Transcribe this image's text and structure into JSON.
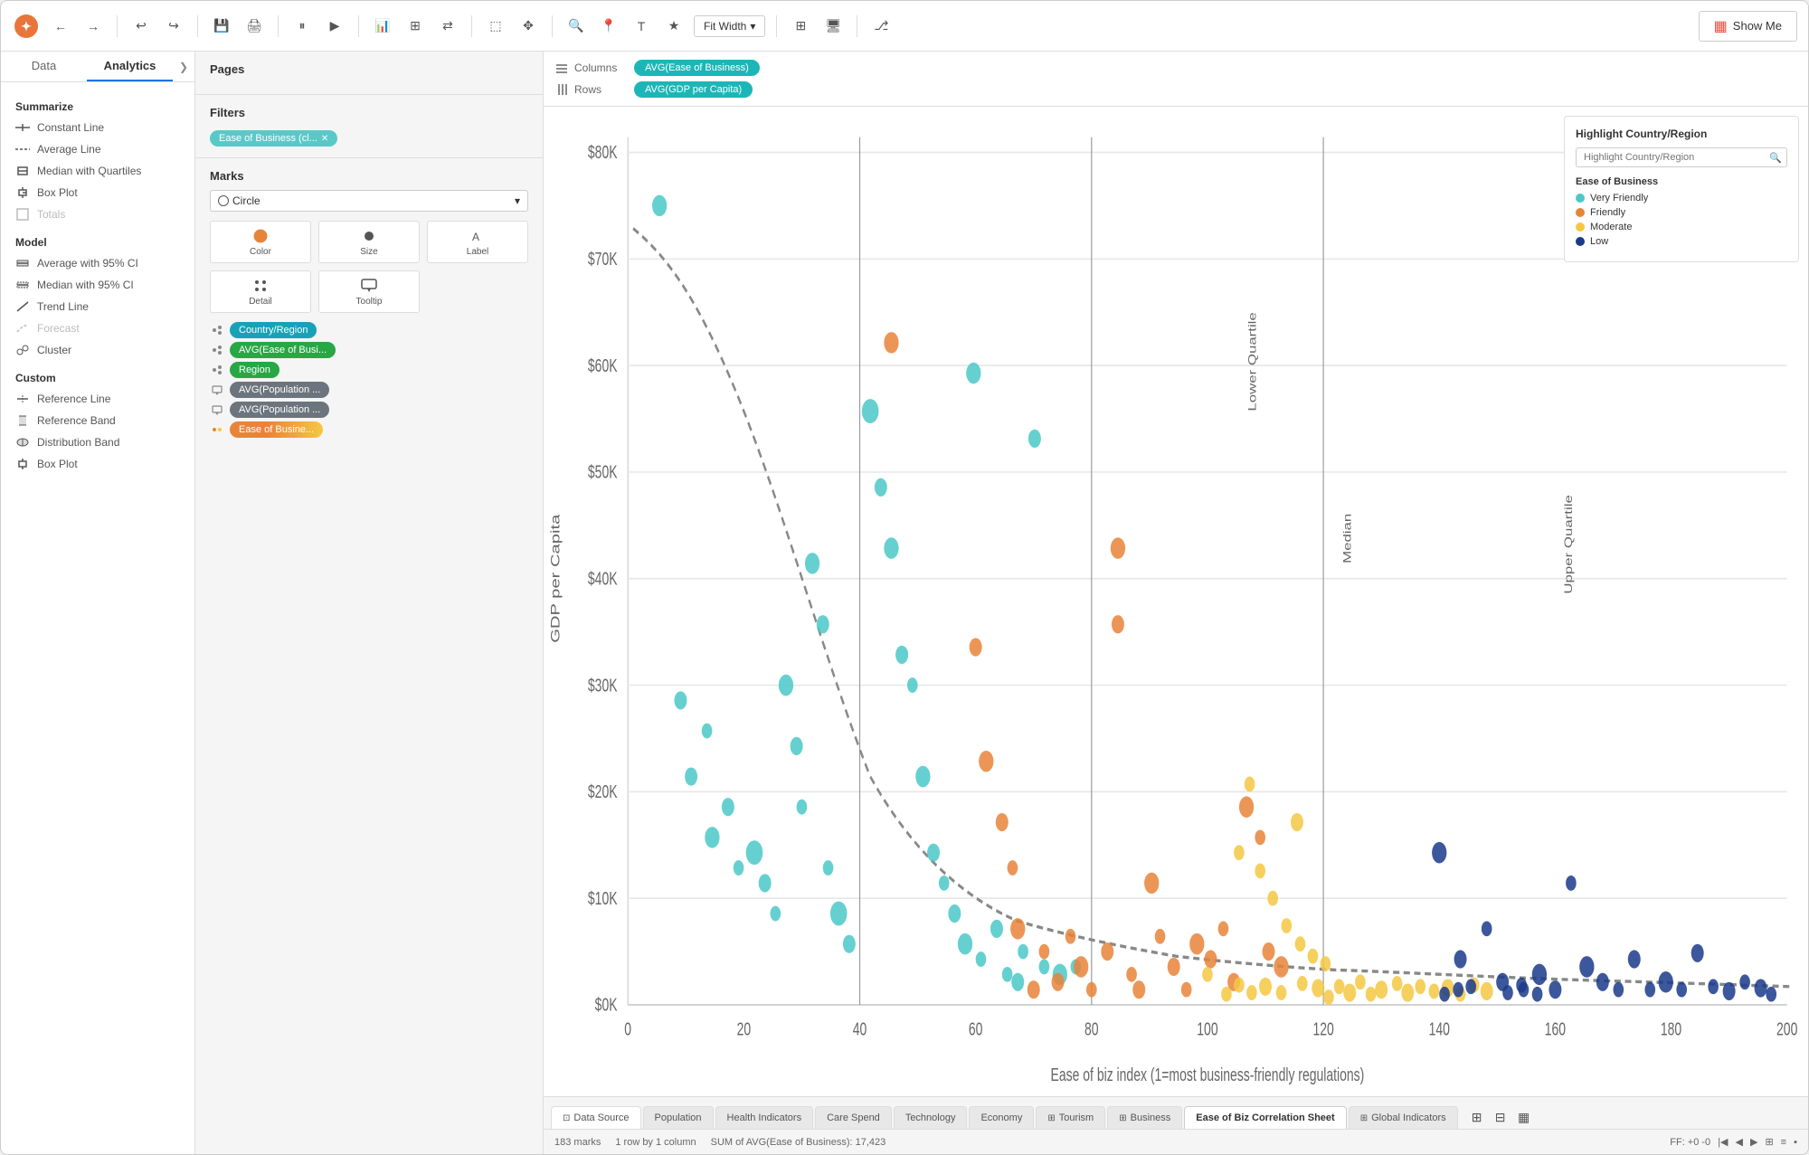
{
  "toolbar": {
    "fit_width_label": "Fit Width",
    "show_me_label": "Show Me",
    "nav_buttons": [
      "back",
      "forward",
      "undo",
      "redo"
    ]
  },
  "left_panel": {
    "tabs": [
      "Data",
      "Analytics"
    ],
    "active_tab": "Analytics",
    "summarize_header": "Summarize",
    "summarize_items": [
      {
        "label": "Constant Line",
        "icon": "constant-line-icon"
      },
      {
        "label": "Average Line",
        "icon": "average-line-icon"
      },
      {
        "label": "Median with Quartiles",
        "icon": "median-quartiles-icon"
      },
      {
        "label": "Box Plot",
        "icon": "box-plot-icon"
      },
      {
        "label": "Totals",
        "icon": "totals-icon",
        "disabled": true
      }
    ],
    "model_header": "Model",
    "model_items": [
      {
        "label": "Average with 95% CI",
        "icon": "avg-ci-icon"
      },
      {
        "label": "Median with 95% CI",
        "icon": "median-ci-icon"
      },
      {
        "label": "Trend Line",
        "icon": "trend-line-icon"
      },
      {
        "label": "Forecast",
        "icon": "forecast-icon",
        "disabled": true
      },
      {
        "label": "Cluster",
        "icon": "cluster-icon"
      }
    ],
    "custom_header": "Custom",
    "custom_items": [
      {
        "label": "Reference Line",
        "icon": "ref-line-icon"
      },
      {
        "label": "Reference Band",
        "icon": "ref-band-icon"
      },
      {
        "label": "Distribution Band",
        "icon": "dist-band-icon"
      },
      {
        "label": "Box Plot",
        "icon": "box-plot2-icon"
      }
    ]
  },
  "middle_panel": {
    "pages_label": "Pages",
    "filters_label": "Filters",
    "filter_pill": "Ease of Business (cl...",
    "marks_label": "Marks",
    "marks_type": "Circle",
    "marks_buttons": [
      "Color",
      "Size",
      "Label",
      "Detail",
      "Tooltip"
    ],
    "field_rows": [
      {
        "icon": "circle-dots",
        "label": "Country/Region",
        "color": "teal"
      },
      {
        "icon": "circle-dots",
        "label": "AVG(Ease of Busi...",
        "color": "green"
      },
      {
        "icon": "circle-dots",
        "label": "Region",
        "color": "green"
      },
      {
        "icon": "tooltip",
        "label": "AVG(Population ...",
        "color": "gray"
      },
      {
        "icon": "tooltip",
        "label": "AVG(Population ...",
        "color": "gray"
      },
      {
        "icon": "multi-color",
        "label": "Ease of Busine...",
        "color": "multi"
      }
    ]
  },
  "shelf": {
    "columns_label": "Columns",
    "columns_icon": "columns-icon",
    "columns_pill": "AVG(Ease of Business)",
    "rows_label": "Rows",
    "rows_icon": "rows-icon",
    "rows_pill": "AVG(GDP per Capita)"
  },
  "chart": {
    "title": "Ease of Biz Correlation Sheet",
    "x_axis_label": "Ease of biz index (1=most business-friendly regulations)",
    "y_axis_label": "GDP per Capita",
    "y_ticks": [
      "$0K",
      "$10K",
      "$20K",
      "$30K",
      "$40K",
      "$50K",
      "$60K",
      "$70K",
      "$80K"
    ],
    "x_ticks": [
      "0",
      "20",
      "40",
      "60",
      "80",
      "100",
      "120",
      "140",
      "160",
      "180",
      "200"
    ],
    "ref_lines": [
      {
        "label": "Lower Quartile",
        "pct": 22
      },
      {
        "label": "Median",
        "pct": 43
      },
      {
        "label": "Upper Quartile",
        "pct": 65
      }
    ]
  },
  "legend": {
    "highlight_title": "Highlight Country/Region",
    "highlight_placeholder": "Highlight Country/Region",
    "ease_title": "Ease of Business",
    "items": [
      {
        "label": "Very Friendly",
        "color": "#4bc8c8"
      },
      {
        "label": "Friendly",
        "color": "#e8843a"
      },
      {
        "label": "Moderate",
        "color": "#f5c842"
      },
      {
        "label": "Low",
        "color": "#1a3a8a"
      }
    ]
  },
  "bottom_tabs": [
    {
      "label": "Data Source",
      "icon": "datasource-icon",
      "active": false
    },
    {
      "label": "Population",
      "icon": "",
      "active": false
    },
    {
      "label": "Health Indicators",
      "icon": "",
      "active": false
    },
    {
      "label": "Care Spend",
      "icon": "",
      "active": false
    },
    {
      "label": "Technology",
      "icon": "",
      "active": false
    },
    {
      "label": "Economy",
      "icon": "",
      "active": false
    },
    {
      "label": "Tourism",
      "icon": "grid-icon",
      "active": false
    },
    {
      "label": "Business",
      "icon": "grid-icon",
      "active": false
    },
    {
      "label": "Ease of Biz Correlation Sheet",
      "icon": "",
      "active": true
    },
    {
      "label": "Global Indicators",
      "icon": "grid-icon",
      "active": false
    }
  ],
  "status_bar": {
    "marks": "183 marks",
    "dimension": "1 row by 1 column",
    "sum_label": "SUM of AVG(Ease of Business): 17,423",
    "ff": "FF: +0 -0"
  }
}
